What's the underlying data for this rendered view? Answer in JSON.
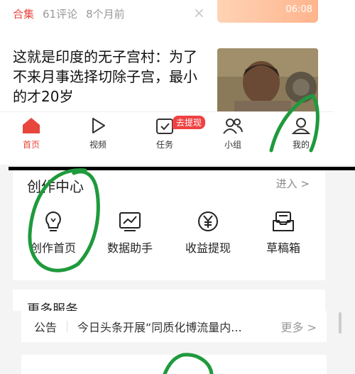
{
  "feed": {
    "meta": {
      "tag": "合集",
      "comments": "61评论",
      "time": "8个月前"
    },
    "close_glyph": "×",
    "top_thumb_text": "06:08",
    "article_title": "这就是印度的无子宫村：为了不来月事选择切除子宫，最小的才20岁"
  },
  "tabbar": {
    "items": [
      {
        "label": "首页",
        "icon": "home-icon",
        "active": true
      },
      {
        "label": "视频",
        "icon": "play-icon",
        "active": false
      },
      {
        "label": "任务",
        "icon": "task-check-icon",
        "active": false
      },
      {
        "label": "小组",
        "icon": "group-icon",
        "active": false
      },
      {
        "label": "我的",
        "icon": "profile-icon",
        "active": false
      }
    ],
    "badge": "去提现",
    "active_color": "#e8453c"
  },
  "creator_center": {
    "title": "创作中心",
    "enter_label": "进入 >",
    "tools": [
      {
        "label": "创作首页",
        "icon": "lightbulb-icon"
      },
      {
        "label": "数据助手",
        "icon": "chart-icon"
      },
      {
        "label": "收益提现",
        "icon": "yen-icon"
      },
      {
        "label": "草稿箱",
        "icon": "drafts-icon"
      }
    ]
  },
  "more_services": {
    "title": "更多服务"
  },
  "notice": {
    "label": "公告",
    "text": "今日头条开展“同质化博流量内...",
    "more": "更多 >"
  }
}
